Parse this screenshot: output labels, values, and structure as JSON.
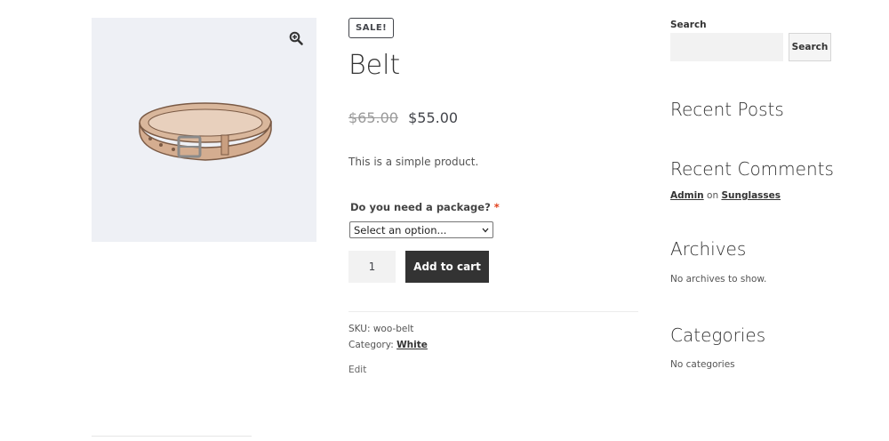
{
  "product": {
    "sale_badge": "SALE!",
    "title": "Belt",
    "old_price": "$65.00",
    "new_price": "$55.00",
    "short_description": "This is a simple product.",
    "image_alt": "belt",
    "zoom_icon": "magnifier-plus-icon"
  },
  "addon": {
    "label": "Do you need a package?",
    "required_mark": "*",
    "select_value": "Select an option..."
  },
  "cart": {
    "quantity": "1",
    "add_to_cart_label": "Add to cart"
  },
  "meta": {
    "sku_label": "SKU:",
    "sku_value": "woo-belt",
    "category_label": "Category:",
    "category_value": "White",
    "edit_label": "Edit"
  },
  "sidebar": {
    "search_label": "Search",
    "search_button": "Search",
    "search_value": "",
    "recent_posts_title": "Recent Posts",
    "recent_comments_title": "Recent Comments",
    "comment_author": "Admin",
    "comment_on": "on",
    "comment_post": "Sunglasses",
    "archives_title": "Archives",
    "archives_empty": "No archives to show.",
    "categories_title": "Categories",
    "categories_empty": "No categories"
  },
  "colors": {
    "button_dark": "#333333",
    "required": "#e2401c",
    "image_bg": "#eef0f5"
  }
}
